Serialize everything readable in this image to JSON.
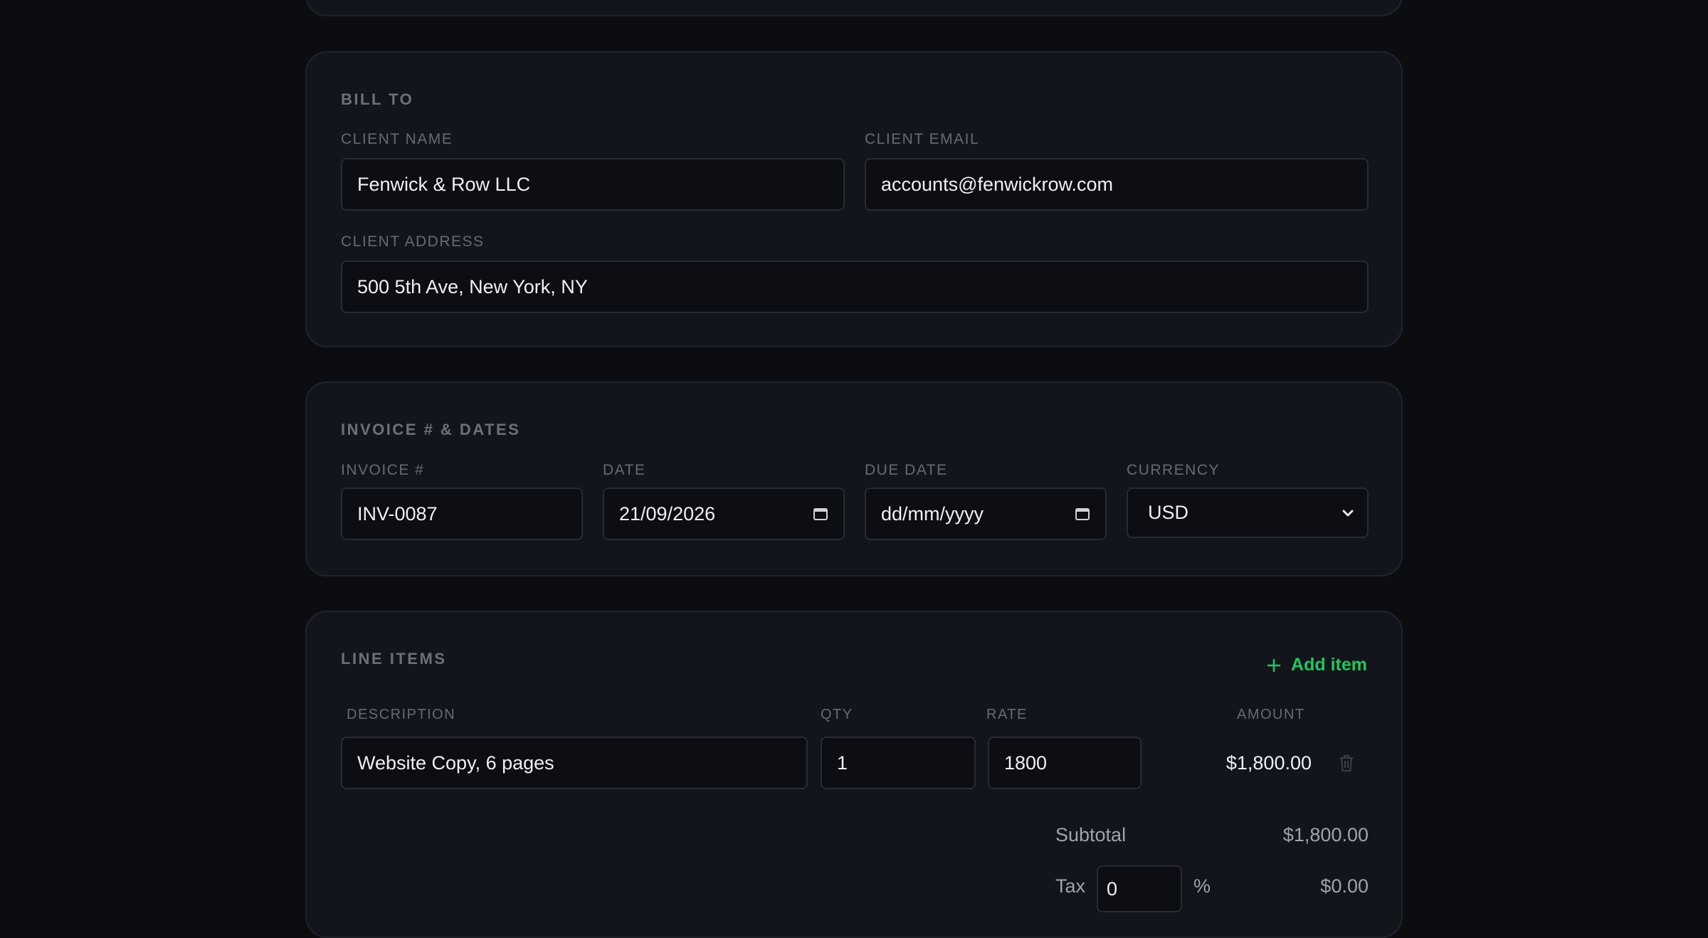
{
  "bill_to": {
    "title": "BILL TO",
    "client_name_label": "CLIENT NAME",
    "client_name_value": "Fenwick & Row LLC",
    "client_email_label": "CLIENT EMAIL",
    "client_email_value": "accounts@fenwickrow.com",
    "client_address_label": "CLIENT ADDRESS",
    "client_address_value": "500 5th Ave, New York, NY"
  },
  "invoice_dates": {
    "title": "INVOICE # & DATES",
    "invoice_label": "INVOICE #",
    "invoice_value": "INV-0087",
    "date_label": "DATE",
    "date_value": "21/09/2026",
    "due_date_label": "DUE DATE",
    "due_date_placeholder": "dd/mm/yyyy",
    "currency_label": "CURRENCY",
    "currency_value": "USD"
  },
  "line_items": {
    "title": "LINE ITEMS",
    "add_item_label": "Add item",
    "columns": {
      "description": "DESCRIPTION",
      "qty": "QTY",
      "rate": "RATE",
      "amount": "AMOUNT"
    },
    "items": [
      {
        "description": "Website Copy, 6 pages",
        "qty": "1",
        "rate": "1800",
        "amount": "$1,800.00"
      }
    ]
  },
  "totals": {
    "subtotal_label": "Subtotal",
    "subtotal_value": "$1,800.00",
    "tax_label": "Tax",
    "tax_rate": "0",
    "tax_percent_sign": "%",
    "tax_value": "$0.00"
  },
  "colors": {
    "accent": "#22c55e",
    "background": "#0b0d11",
    "card": "#12151c",
    "input": "#0c0e13"
  },
  "icons": {
    "add": "plus-icon",
    "delete": "trash-icon",
    "date": "calendar-icon",
    "select": "chevron-down-icon"
  }
}
